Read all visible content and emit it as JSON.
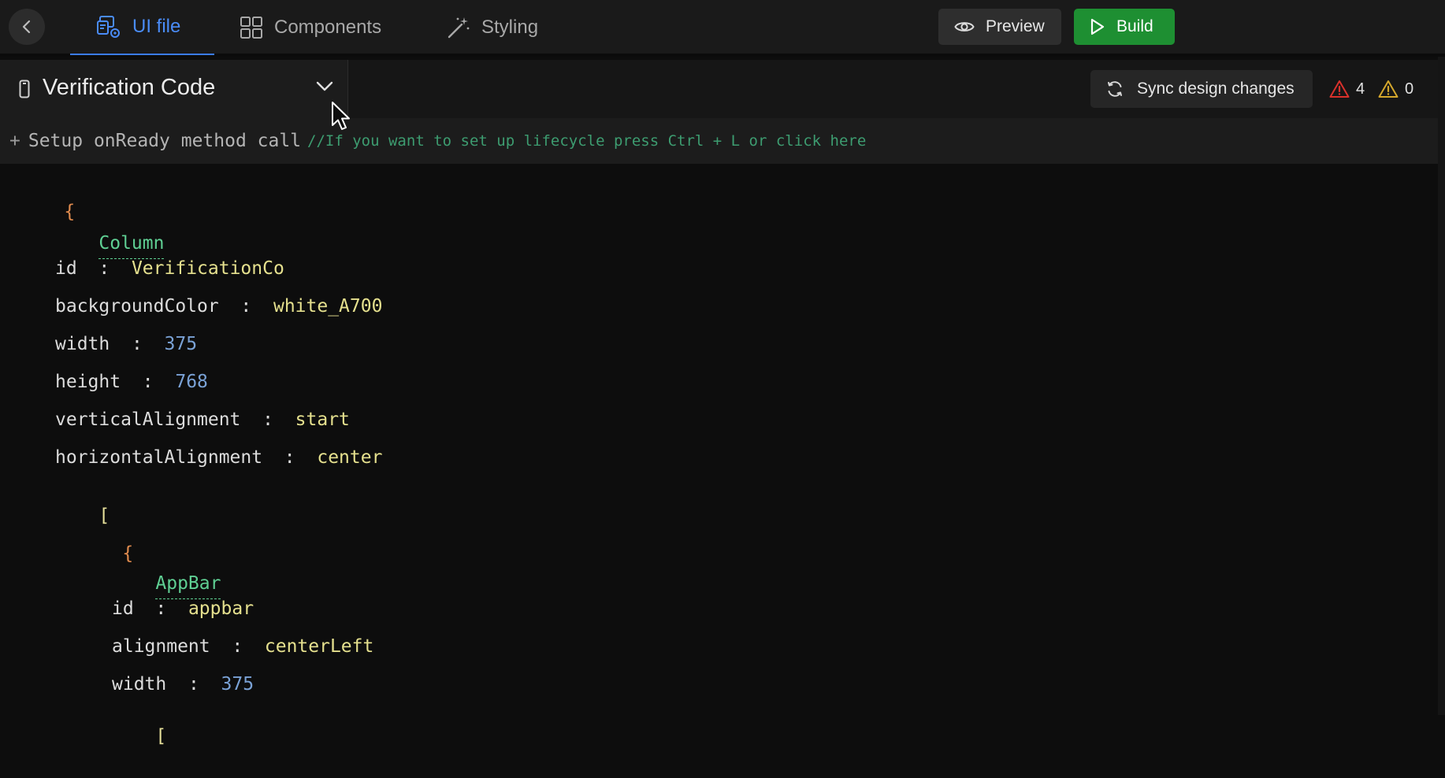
{
  "tabs": [
    {
      "label": "UI file",
      "icon": "ui-file-icon",
      "active": true
    },
    {
      "label": "Components",
      "icon": "components-grid-icon",
      "active": false
    },
    {
      "label": "Styling",
      "icon": "magic-wand-icon",
      "active": false
    }
  ],
  "toolbar": {
    "preview_label": "Preview",
    "build_label": "Build"
  },
  "screen": {
    "title": "Verification Code"
  },
  "sync": {
    "label": "Sync design changes"
  },
  "issues": {
    "errors": "4",
    "warnings": "0"
  },
  "lifecycle": {
    "plus": "+",
    "label": "Setup onReady method call",
    "comment": "//If you want to set up lifecycle press Ctrl + L or click here"
  },
  "code": {
    "open_brace": "{",
    "column": {
      "widget": "Column",
      "id_key": "id",
      "id_val": "VerificationCo",
      "bg_key": "backgroundColor",
      "bg_val": "white_A700",
      "width_key": "width",
      "width_val": "375",
      "height_key": "height",
      "height_val": "768",
      "valign_key": "verticalAlignment",
      "valign_val": "start",
      "halign_key": "horizontalAlignment",
      "halign_val": "center"
    },
    "open_bracket": "[",
    "inner_brace": "{",
    "appbar": {
      "widget": "AppBar",
      "id_key": "id",
      "id_val": "appbar",
      "align_key": "alignment",
      "align_val": "centerLeft",
      "width_key": "width",
      "width_val": "375"
    },
    "partial_bracket": "["
  },
  "colors": {
    "accent": "#3b7bef",
    "build": "#1e8f32",
    "widget": "#5fcf93",
    "string": "#e5e08e",
    "number": "#7aa2d6",
    "brace": "#e08b4e",
    "comment": "#3d9c70",
    "error": "#d9312b",
    "warning": "#d4a72c"
  }
}
